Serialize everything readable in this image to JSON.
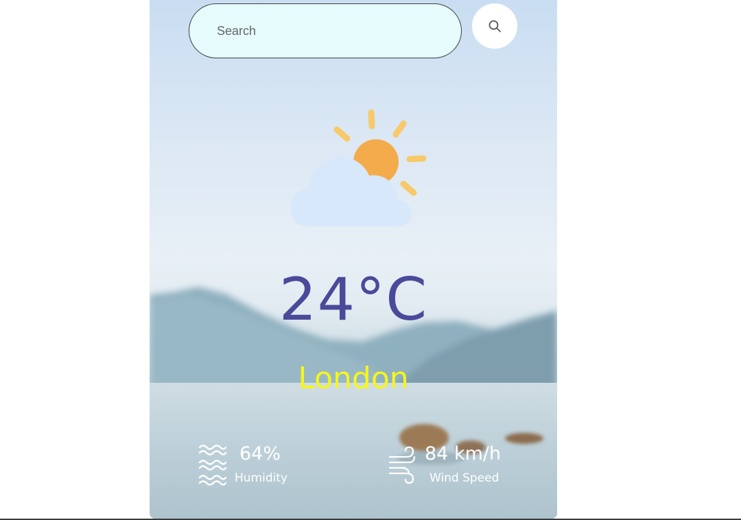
{
  "search": {
    "placeholder": "Search",
    "icon": "search-icon"
  },
  "weather": {
    "icon": "partly-cloudy-icon",
    "temperature": "24°C",
    "city": "London"
  },
  "details": {
    "humidity": {
      "value": "64%",
      "label": "Humidity",
      "icon": "humidity-icon"
    },
    "wind": {
      "value": "84 km/h",
      "label": "Wind Speed",
      "icon": "wind-icon"
    }
  },
  "colors": {
    "temperature": "#4a4a9a",
    "city": "#f6f61a",
    "search_bg": "#e6fbfb",
    "sun": "#f4ab4c",
    "rays": "#f7c96a",
    "cloud": "#d6e8fa"
  }
}
